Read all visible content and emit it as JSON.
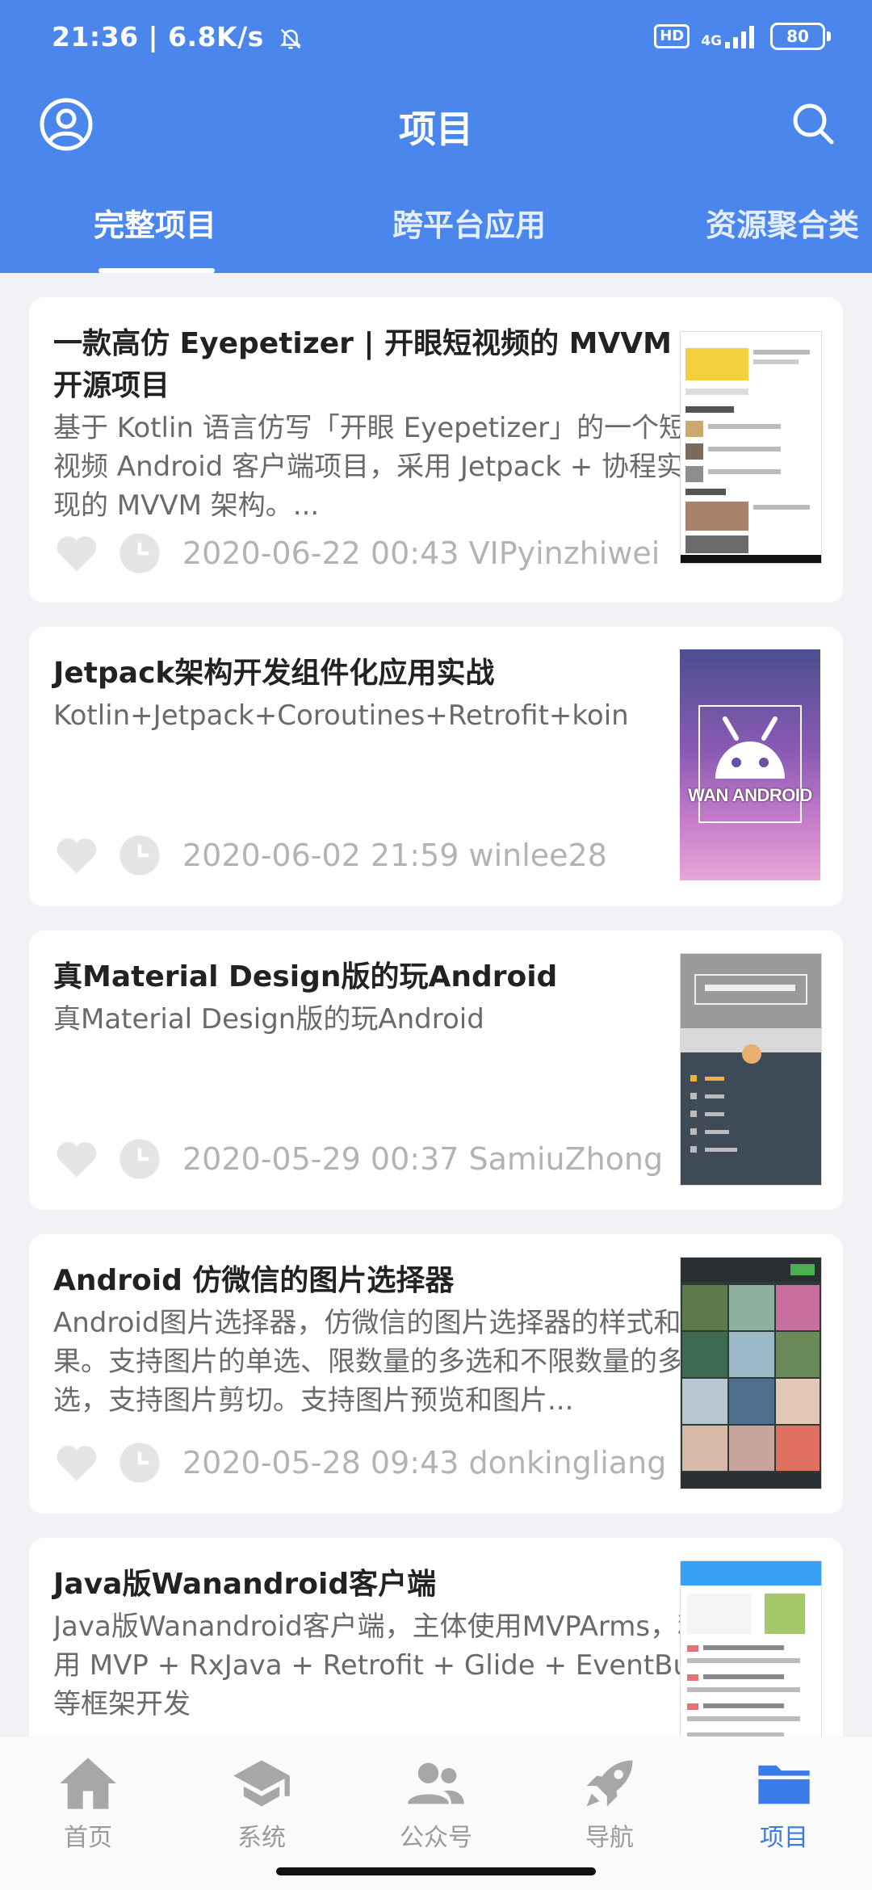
{
  "status": {
    "time_speed": "21:36 | 6.8K/s",
    "hd": "HD",
    "network": "4G",
    "battery": "80"
  },
  "header": {
    "title": "项目"
  },
  "tabs": [
    "完整项目",
    "跨平台应用",
    "资源聚合类"
  ],
  "projects": [
    {
      "title": "一款高仿 Eyepetizer | 开眼短视频的 MVVM 开源项目",
      "desc": "基于 Kotlin 语言仿写「开眼 Eyepetizer」的一个短视频 Android 客户端项目，采用 Jetpack + 协程实现的 MVVM 架构。...",
      "meta": "2020-06-22 00:43 VIPyinzhiwei"
    },
    {
      "title": "Jetpack架构开发组件化应用实战",
      "desc": "Kotlin+Jetpack+Coroutines+Retrofit+koin",
      "meta": "2020-06-02 21:59 winlee28",
      "thumb_text": "WAN ANDROID"
    },
    {
      "title": "真Material Design版的玩Android",
      "desc": "真Material Design版的玩Android",
      "meta": "2020-05-29 00:37 SamiuZhong"
    },
    {
      "title": "Android 仿微信的图片选择器",
      "desc": "Android图片选择器，仿微信的图片选择器的样式和效果。支持图片的单选、限数量的多选和不限数量的多选，支持图片剪切。支持图片预览和图片...",
      "meta": "2020-05-28 09:43 donkingliang"
    },
    {
      "title": "Java版Wanandroid客户端",
      "desc": "Java版Wanandroid客户端，主体使用MVPArms，利用 MVP + RxJava + Retrofit + Glide + EventBus等框架开发",
      "meta": ""
    }
  ],
  "bottom_nav": [
    "首页",
    "系统",
    "公众号",
    "导航",
    "项目"
  ],
  "colors": {
    "primary": "#4A86EC",
    "active": "#3A7BE8",
    "inactive": "#9A9A9A"
  }
}
